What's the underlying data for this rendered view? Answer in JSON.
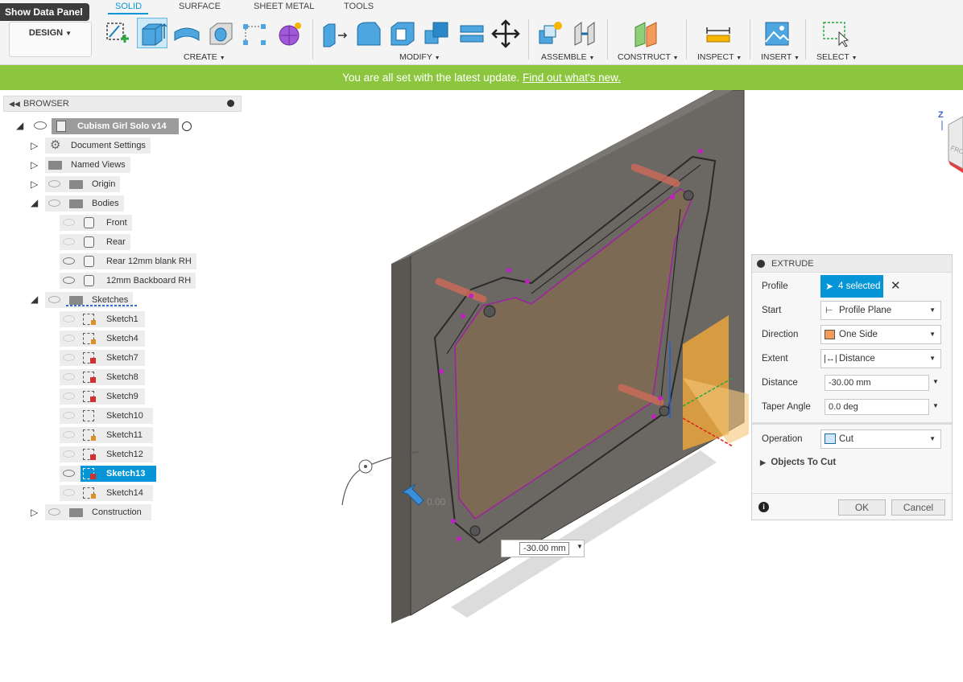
{
  "app": {
    "show_data_panel": "Show Data Panel",
    "workspace": "DESIGN"
  },
  "tabs": [
    {
      "label": "SOLID",
      "active": true
    },
    {
      "label": "SURFACE",
      "active": false
    },
    {
      "label": "SHEET METAL",
      "active": false
    },
    {
      "label": "TOOLS",
      "active": false
    }
  ],
  "groups": {
    "create": "CREATE",
    "modify": "MODIFY",
    "assemble": "ASSEMBLE",
    "construct": "CONSTRUCT",
    "inspect": "INSPECT",
    "insert": "INSERT",
    "select": "SELECT"
  },
  "banner": {
    "text": "You are all set with the latest update.",
    "link": "Find out what's new."
  },
  "browser": {
    "title": "BROWSER",
    "root": "Cubism Girl Solo v14",
    "items": {
      "document_settings": "Document Settings",
      "named_views": "Named Views",
      "origin": "Origin",
      "bodies": "Bodies",
      "front": "Front",
      "rear": "Rear",
      "rear12": "Rear 12mm blank RH",
      "backboard": "12mm Backboard RH",
      "sketches": "Sketches",
      "construction": "Construction"
    },
    "sketches": [
      "Sketch1",
      "Sketch4",
      "Sketch7",
      "Sketch8",
      "Sketch9",
      "Sketch10",
      "Sketch11",
      "Sketch12",
      "Sketch13",
      "Sketch14"
    ],
    "selected_sketch": "Sketch13"
  },
  "extrude": {
    "title": "EXTRUDE",
    "profile_label": "Profile",
    "profile_value": "4 selected",
    "start_label": "Start",
    "start_value": "Profile Plane",
    "direction_label": "Direction",
    "direction_value": "One Side",
    "extent_label": "Extent",
    "extent_value": "Distance",
    "distance_label": "Distance",
    "distance_value": "-30.00 mm",
    "taper_label": "Taper Angle",
    "taper_value": "0.0 deg",
    "operation_label": "Operation",
    "operation_value": "Cut",
    "objects_to_cut": "Objects To Cut",
    "ok": "OK",
    "cancel": "Cancel"
  },
  "canvas": {
    "distance_input": "-30.00 mm",
    "manipulator_readout": "0.00",
    "viewcube_label": "FRONT",
    "axis_z": "Z"
  }
}
